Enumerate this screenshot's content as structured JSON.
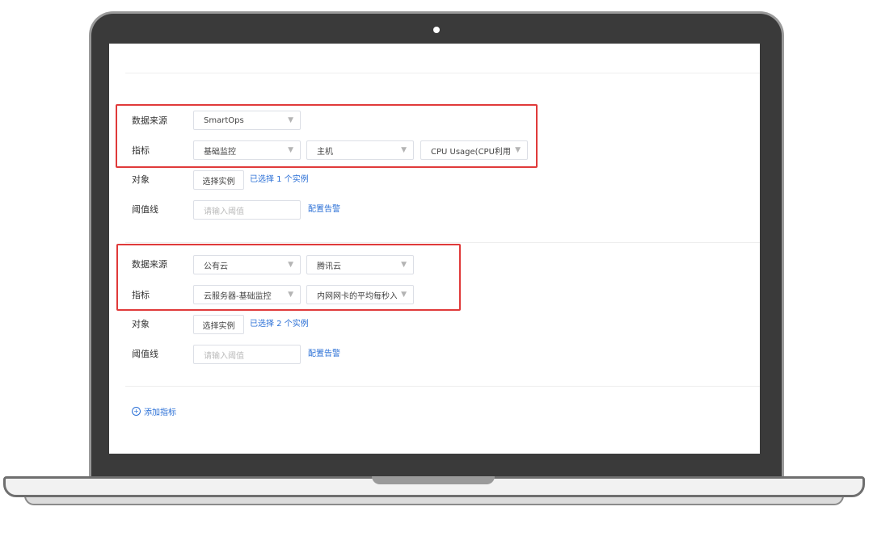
{
  "group1": {
    "source_label": "数据来源",
    "source_value": "SmartOps",
    "metric_label": "指标",
    "metric_values": [
      "基础监控",
      "主机",
      "CPU Usage(CPU利用率)"
    ],
    "object_label": "对象",
    "select_instance_label": "选择实例",
    "selected_text": "已选择 1 个实例",
    "threshold_label": "阈值线",
    "threshold_placeholder": "请输入阈值",
    "alert_link": "配置告警"
  },
  "group2": {
    "source_label": "数据来源",
    "source_values": [
      "公有云",
      "腾讯云"
    ],
    "metric_label": "指标",
    "metric_values": [
      "云服务器-基础监控",
      "内网网卡的平均每秒入包量"
    ],
    "object_label": "对象",
    "select_instance_label": "选择实例",
    "selected_text": "已选择 2 个实例",
    "threshold_label": "阈值线",
    "threshold_placeholder": "请输入阈值",
    "alert_link": "配置告警"
  },
  "add_metric_label": "添加指标",
  "icons": {
    "dropdown": "caret-down-icon",
    "add": "plus-circle-icon"
  },
  "colors": {
    "link": "#2a6fd6",
    "highlight": "#e03a3a",
    "laptop_bezel": "#3a3a3a"
  }
}
